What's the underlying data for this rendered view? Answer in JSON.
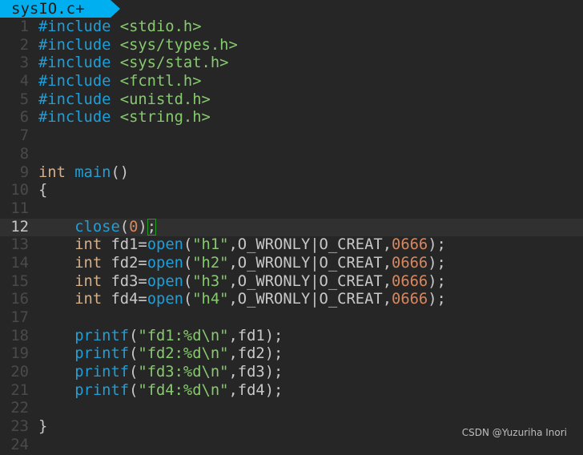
{
  "tab": {
    "title": "sysIO.c+"
  },
  "current_line": 12,
  "lines": [
    [
      [
        "pre",
        "#include "
      ],
      [
        "str",
        "<stdio.h>"
      ]
    ],
    [
      [
        "pre",
        "#include "
      ],
      [
        "str",
        "<sys/types.h>"
      ]
    ],
    [
      [
        "pre",
        "#include "
      ],
      [
        "str",
        "<sys/stat.h>"
      ]
    ],
    [
      [
        "pre",
        "#include "
      ],
      [
        "str",
        "<fcntl.h>"
      ]
    ],
    [
      [
        "pre",
        "#include "
      ],
      [
        "str",
        "<unistd.h>"
      ]
    ],
    [
      [
        "pre",
        "#include "
      ],
      [
        "str",
        "<string.h>"
      ]
    ],
    [],
    [],
    [
      [
        "type",
        "int"
      ],
      [
        "txt",
        " "
      ],
      [
        "fn",
        "main"
      ],
      [
        "txt",
        "()"
      ]
    ],
    [
      [
        "txt",
        "{"
      ]
    ],
    [],
    [
      [
        "txt",
        "    "
      ],
      [
        "fn",
        "close"
      ],
      [
        "txt",
        "("
      ],
      [
        "num",
        "0"
      ],
      [
        "txt",
        ")"
      ],
      [
        "match",
        ";"
      ]
    ],
    [
      [
        "txt",
        "    "
      ],
      [
        "type",
        "int"
      ],
      [
        "txt",
        " fd1="
      ],
      [
        "fn",
        "open"
      ],
      [
        "txt",
        "("
      ],
      [
        "str",
        "\"h1\""
      ],
      [
        "txt",
        ",O_WRONLY|O_CREAT,"
      ],
      [
        "num",
        "0666"
      ],
      [
        "txt",
        ");"
      ]
    ],
    [
      [
        "txt",
        "    "
      ],
      [
        "type",
        "int"
      ],
      [
        "txt",
        " fd2="
      ],
      [
        "fn",
        "open"
      ],
      [
        "txt",
        "("
      ],
      [
        "str",
        "\"h2\""
      ],
      [
        "txt",
        ",O_WRONLY|O_CREAT,"
      ],
      [
        "num",
        "0666"
      ],
      [
        "txt",
        ");"
      ]
    ],
    [
      [
        "txt",
        "    "
      ],
      [
        "type",
        "int"
      ],
      [
        "txt",
        " fd3="
      ],
      [
        "fn",
        "open"
      ],
      [
        "txt",
        "("
      ],
      [
        "str",
        "\"h3\""
      ],
      [
        "txt",
        ",O_WRONLY|O_CREAT,"
      ],
      [
        "num",
        "0666"
      ],
      [
        "txt",
        ");"
      ]
    ],
    [
      [
        "txt",
        "    "
      ],
      [
        "type",
        "int"
      ],
      [
        "txt",
        " fd4="
      ],
      [
        "fn",
        "open"
      ],
      [
        "txt",
        "("
      ],
      [
        "str",
        "\"h4\""
      ],
      [
        "txt",
        ",O_WRONLY|O_CREAT,"
      ],
      [
        "num",
        "0666"
      ],
      [
        "txt",
        ");"
      ]
    ],
    [],
    [
      [
        "txt",
        "    "
      ],
      [
        "fn",
        "printf"
      ],
      [
        "txt",
        "("
      ],
      [
        "str",
        "\"fd1:%d\\n\""
      ],
      [
        "txt",
        ",fd1);"
      ]
    ],
    [
      [
        "txt",
        "    "
      ],
      [
        "fn",
        "printf"
      ],
      [
        "txt",
        "("
      ],
      [
        "str",
        "\"fd2:%d\\n\""
      ],
      [
        "txt",
        ",fd2);"
      ]
    ],
    [
      [
        "txt",
        "    "
      ],
      [
        "fn",
        "printf"
      ],
      [
        "txt",
        "("
      ],
      [
        "str",
        "\"fd3:%d\\n\""
      ],
      [
        "txt",
        ",fd3);"
      ]
    ],
    [
      [
        "txt",
        "    "
      ],
      [
        "fn",
        "printf"
      ],
      [
        "txt",
        "("
      ],
      [
        "str",
        "\"fd4:%d\\n\""
      ],
      [
        "txt",
        ",fd4);"
      ]
    ],
    [],
    [
      [
        "txt",
        "}"
      ]
    ],
    []
  ],
  "watermark": "CSDN @Yuzuriha  Inori"
}
